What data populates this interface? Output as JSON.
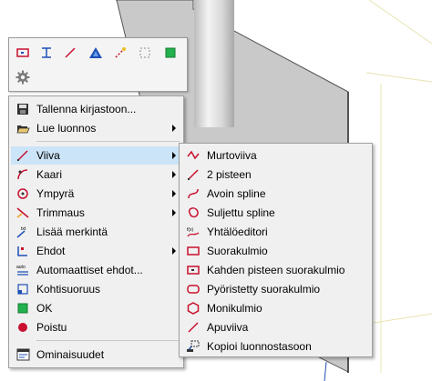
{
  "toolbar": {
    "buttons": [
      {
        "icon": "rectangle-icon"
      },
      {
        "icon": "text-icon"
      },
      {
        "icon": "line-icon"
      },
      {
        "icon": "triangle-icon"
      },
      {
        "icon": "construction-icon"
      },
      {
        "icon": "dashed-rect-icon"
      },
      {
        "icon": "green-square-icon"
      },
      {
        "icon": "gear-icon"
      }
    ]
  },
  "context_menu": {
    "items": [
      {
        "label": "Tallenna kirjastoon...",
        "icon": "save-icon",
        "submenu": false
      },
      {
        "label": "Lue luonnos",
        "icon": "open-folder-icon",
        "submenu": true
      },
      {
        "label": "Viiva",
        "icon": "line-icon",
        "submenu": true,
        "highlighted": true
      },
      {
        "label": "Kaari",
        "icon": "arc-icon",
        "submenu": true
      },
      {
        "label": "Ympyrä",
        "icon": "circle-icon",
        "submenu": true
      },
      {
        "label": "Trimmaus",
        "icon": "trim-icon",
        "submenu": true
      },
      {
        "label": "Lisää merkintä",
        "icon": "annotation-icon",
        "submenu": false
      },
      {
        "label": "Ehdot",
        "icon": "constraints-icon",
        "submenu": true
      },
      {
        "label": "Automaattiset ehdot...",
        "icon": "auto-constraints-icon",
        "submenu": false
      },
      {
        "label": "Kohtisuoruus",
        "icon": "perpendicular-icon",
        "submenu": false
      },
      {
        "label": "OK",
        "icon": "ok-icon",
        "submenu": false
      },
      {
        "label": "Poistu",
        "icon": "exit-icon",
        "submenu": false
      },
      {
        "label": "Ominaisuudet",
        "icon": "properties-icon",
        "submenu": false
      }
    ]
  },
  "submenu": {
    "items": [
      {
        "label": "Murtoviiva",
        "icon": "polyline-icon"
      },
      {
        "label": "2 pisteen",
        "icon": "two-point-line-icon"
      },
      {
        "label": "Avoin spline",
        "icon": "open-spline-icon"
      },
      {
        "label": "Suljettu spline",
        "icon": "closed-spline-icon"
      },
      {
        "label": "Yhtälöeditori",
        "icon": "equation-editor-icon"
      },
      {
        "label": "Suorakulmio",
        "icon": "rectangle-icon"
      },
      {
        "label": "Kahden pisteen suorakulmio",
        "icon": "two-point-rectangle-icon"
      },
      {
        "label": "Pyöristetty suorakulmio",
        "icon": "rounded-rectangle-icon"
      },
      {
        "label": "Monikulmio",
        "icon": "polygon-icon"
      },
      {
        "label": "Apuviiva",
        "icon": "construction-line-icon"
      },
      {
        "label": "Kopioi luonnostasoon",
        "icon": "copy-to-sketch-icon"
      }
    ]
  },
  "colors": {
    "icon_red": "#c8102e",
    "icon_blue": "#1f4fb8",
    "highlight": "#cce4f7",
    "plane_gray": "#c9c9c9",
    "green": "#22b14c"
  }
}
